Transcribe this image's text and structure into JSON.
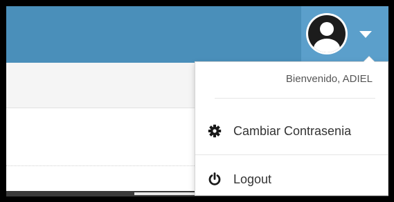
{
  "header": {
    "background_color": "#4a8fba",
    "user_toggle_color": "#5b9fcb",
    "avatar_icon": "user-avatar-icon",
    "caret_icon": "caret-down-icon"
  },
  "user_menu": {
    "welcome_text": "Bienvenido, ADIEL",
    "items": [
      {
        "label": "Cambiar Contrasenia",
        "icon": "gear-icon"
      },
      {
        "label": "Logout",
        "icon": "power-icon"
      }
    ]
  }
}
